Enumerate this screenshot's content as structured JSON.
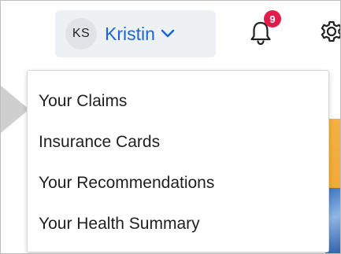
{
  "header": {
    "user": {
      "initials": "KS",
      "name": "Kristin"
    },
    "notifications": {
      "count": "9"
    }
  },
  "dropdown": {
    "items": [
      {
        "label": "Your Claims"
      },
      {
        "label": "Insurance Cards"
      },
      {
        "label": "Your Recommendations"
      },
      {
        "label": "Your Health Summary"
      }
    ]
  },
  "colors": {
    "accent": "#1a66d9",
    "badge": "#e21b4d",
    "user_menu_bg": "#eef1f4"
  },
  "icons": {
    "user_menu": "chevron-down-icon",
    "notifications": "bell-icon",
    "settings": "gear-icon"
  }
}
